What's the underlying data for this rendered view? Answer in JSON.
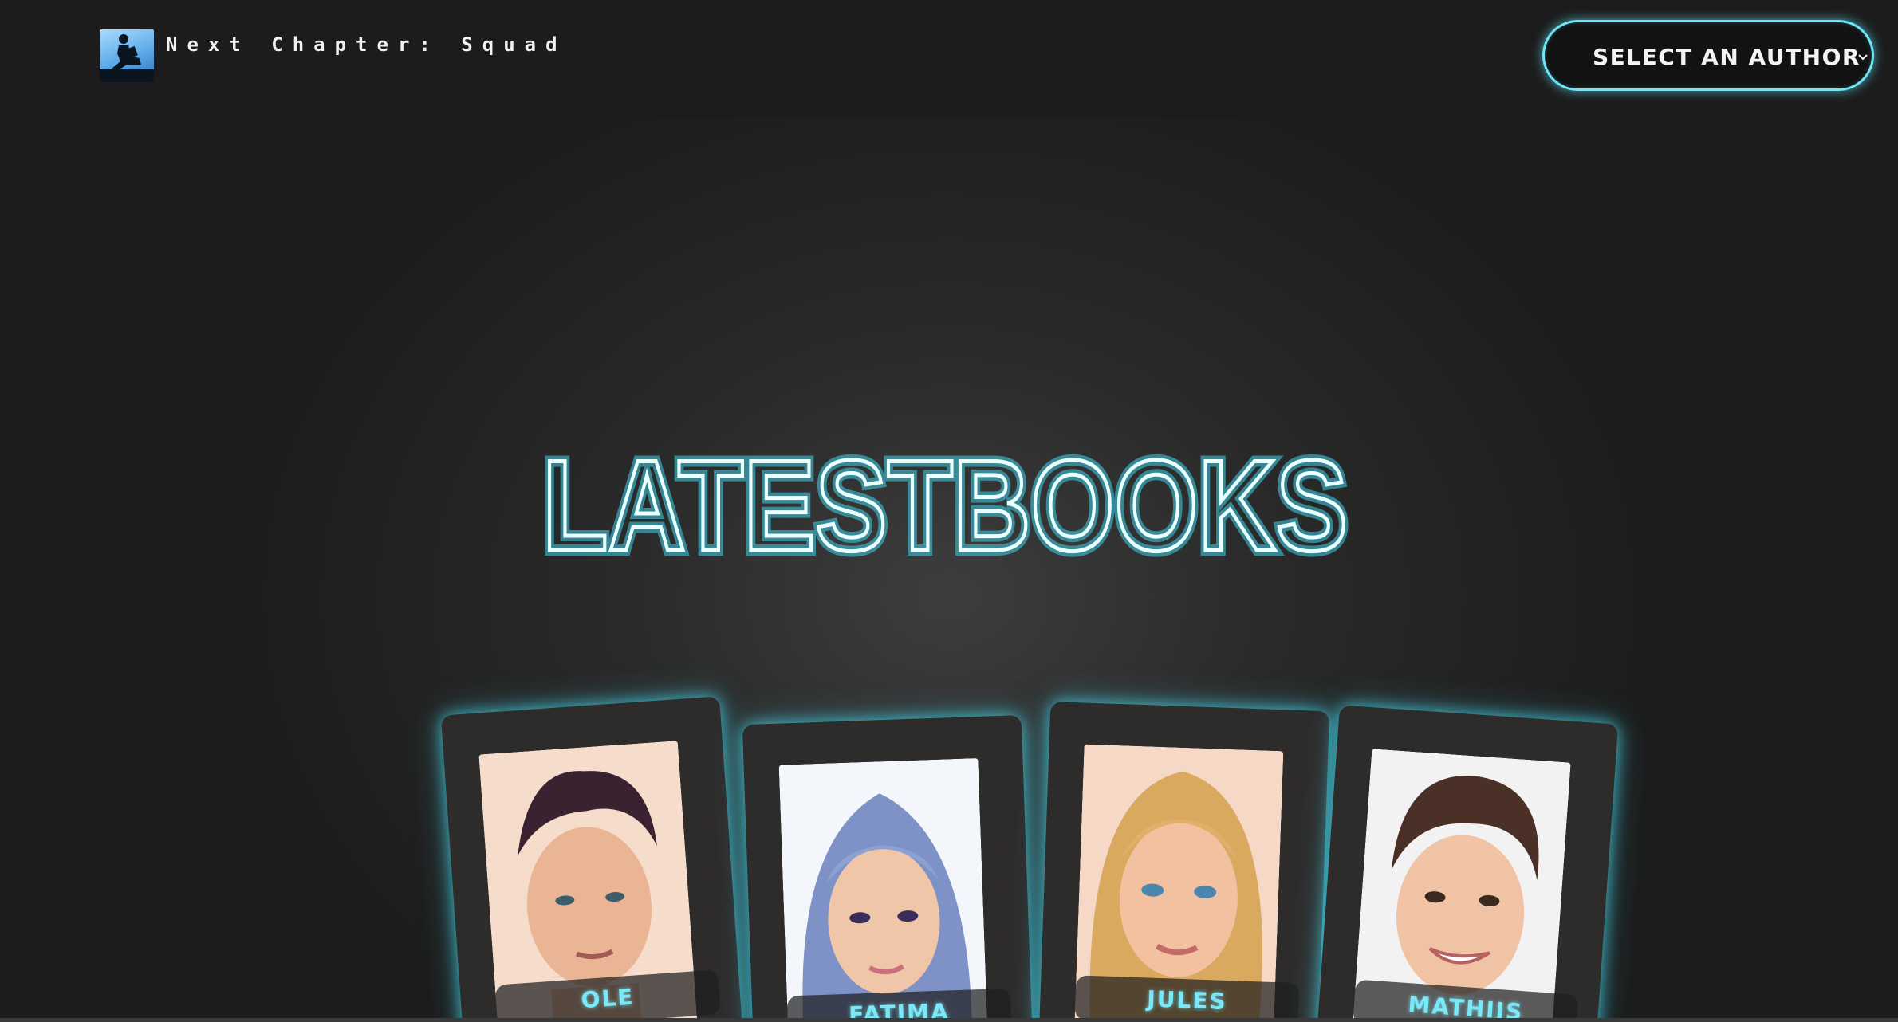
{
  "header": {
    "brand": "Next Chapter: Squad",
    "logo_icon": "reading-person-icon",
    "author_select": {
      "label": "SELECT AN AUTHOR",
      "icon": "chevron-down-icon"
    }
  },
  "hero": {
    "title": "LATESTBOOKS"
  },
  "authors": [
    {
      "name": "OLE"
    },
    {
      "name": "FATIMA"
    },
    {
      "name": "JULES"
    },
    {
      "name": "MATHIJS"
    }
  ],
  "colors": {
    "accent": "#6fe6f7",
    "background": "#1c1c1c",
    "card": "#2e2b2b"
  }
}
